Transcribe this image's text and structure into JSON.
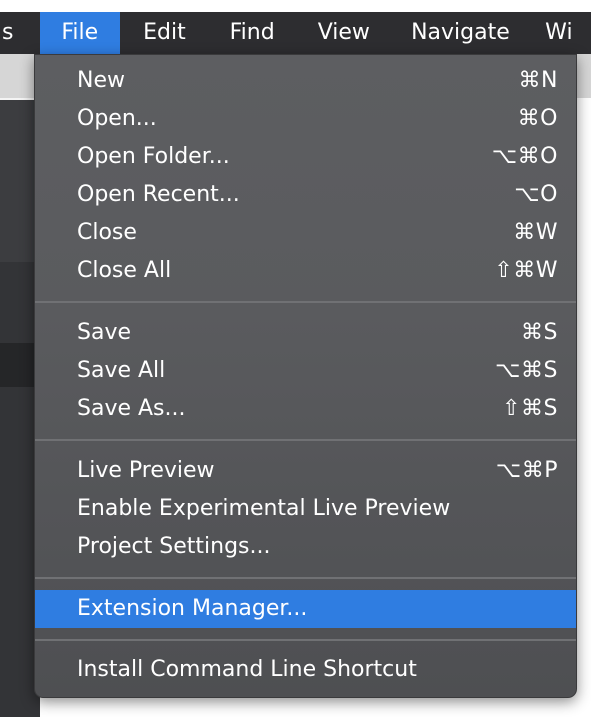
{
  "menubar": {
    "items": [
      {
        "label": "s",
        "active": false
      },
      {
        "label": "File",
        "active": true
      },
      {
        "label": "Edit",
        "active": false
      },
      {
        "label": "Find",
        "active": false
      },
      {
        "label": "View",
        "active": false
      },
      {
        "label": "Navigate",
        "active": false
      },
      {
        "label": "Wi",
        "active": false
      }
    ]
  },
  "file_menu": {
    "items": [
      {
        "label": "New",
        "shortcut": "⌘N"
      },
      {
        "label": "Open...",
        "shortcut": "⌘O"
      },
      {
        "label": "Open Folder...",
        "shortcut": "⌥⌘O"
      },
      {
        "label": "Open Recent...",
        "shortcut": "⌥O"
      },
      {
        "label": "Close",
        "shortcut": "⌘W"
      },
      {
        "label": "Close All",
        "shortcut": "⇧⌘W"
      },
      {
        "label": "Save",
        "shortcut": "⌘S"
      },
      {
        "label": "Save All",
        "shortcut": "⌥⌘S"
      },
      {
        "label": "Save As...",
        "shortcut": "⇧⌘S"
      },
      {
        "label": "Live Preview",
        "shortcut": "⌥⌘P"
      },
      {
        "label": "Enable Experimental Live Preview",
        "shortcut": ""
      },
      {
        "label": "Project Settings...",
        "shortcut": ""
      },
      {
        "label": "Extension Manager...",
        "shortcut": "",
        "highlighted": true
      },
      {
        "label": "Install Command Line Shortcut",
        "shortcut": ""
      }
    ]
  },
  "colors": {
    "menubar_bg": "#2d2d30",
    "menu_bg": "#5a5b5e",
    "highlight": "#2f7de1",
    "text": "#ffffff"
  }
}
